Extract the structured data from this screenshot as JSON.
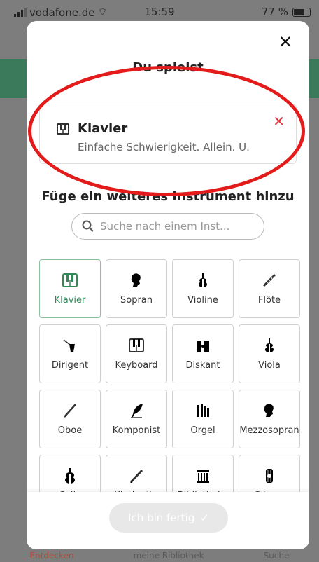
{
  "status": {
    "carrier": "vodafone.de",
    "time": "15:59",
    "battery": "77 %",
    "battery_level": 0.77
  },
  "modal": {
    "title": "Du spielst",
    "current_instrument": {
      "name": "Klavier",
      "details": "Einfache Schwierigkeit. Allein. U."
    },
    "add_section_title": "Füge ein weiteres Instrument hinzu",
    "search_placeholder": "Suche nach einem Inst...",
    "instruments": [
      {
        "label": "Klavier",
        "icon": "piano-icon",
        "selected": true
      },
      {
        "label": "Sopran",
        "icon": "head-icon",
        "selected": false
      },
      {
        "label": "Violine",
        "icon": "violin-icon",
        "selected": false
      },
      {
        "label": "Flöte",
        "icon": "flute-icon",
        "selected": false
      },
      {
        "label": "Dirigent",
        "icon": "conductor-icon",
        "selected": false
      },
      {
        "label": "Keyboard",
        "icon": "keyboard-icon",
        "selected": false
      },
      {
        "label": "Diskant",
        "icon": "diskant-icon",
        "selected": false
      },
      {
        "label": "Viola",
        "icon": "viola-icon",
        "selected": false
      },
      {
        "label": "Oboe",
        "icon": "oboe-icon",
        "selected": false
      },
      {
        "label": "Komponist",
        "icon": "quill-icon",
        "selected": false
      },
      {
        "label": "Orgel",
        "icon": "organ-icon",
        "selected": false
      },
      {
        "label": "Mezzosopran",
        "icon": "head-icon",
        "selected": false
      },
      {
        "label": "Cello",
        "icon": "cello-icon",
        "selected": false
      },
      {
        "label": "Klarinette",
        "icon": "clarinet-icon",
        "selected": false
      },
      {
        "label": "Bibliotheka",
        "icon": "library-icon",
        "selected": false
      },
      {
        "label": "Gitarre",
        "icon": "guitar-icon",
        "selected": false
      }
    ],
    "done_button": "Ich bin fertig"
  },
  "tabs": [
    "Entdecken",
    "meine Bibliothek",
    "Suche"
  ],
  "colors": {
    "accent_green": "#2f8a57",
    "remove_red": "#e0313a",
    "annotation_red": "#e31b1b"
  }
}
